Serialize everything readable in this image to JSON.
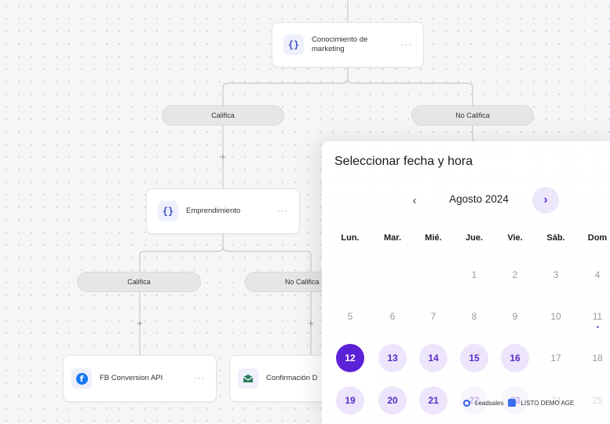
{
  "flow": {
    "nodes": {
      "root": {
        "label": "Conocimiento de marketing",
        "icon": "braces-icon",
        "more": "···"
      },
      "emprendimiento": {
        "label": "Emprendimiento",
        "icon": "braces-icon",
        "more": "···"
      },
      "fb": {
        "label": "FB Conversion API",
        "icon": "facebook-icon",
        "more": "···"
      },
      "confirmacion": {
        "label": "Confirmación D",
        "icon": "mail-icon"
      }
    },
    "branches": {
      "califica_1": "Califica",
      "no_califica_1": "No Califica",
      "califica_2": "Califica",
      "no_califica_2": "No Califica"
    },
    "plus": "+"
  },
  "calendar": {
    "title": "Seleccionar fecha y hora",
    "month": "Agosto 2024",
    "prev": "‹",
    "next": "›",
    "weekdays": [
      "Lun.",
      "Mar.",
      "Mié.",
      "Jue.",
      "Vie.",
      "Sáb.",
      "Dom"
    ],
    "weeks": [
      [
        "",
        "",
        "",
        "1",
        "2",
        "3",
        "4"
      ],
      [
        "5",
        "6",
        "7",
        "8",
        "9",
        "10",
        "11"
      ],
      [
        "12",
        "13",
        "14",
        "15",
        "16",
        "17",
        "18"
      ],
      [
        "19",
        "20",
        "21",
        "22",
        "23",
        "24",
        "25"
      ]
    ],
    "selected_day": "12",
    "available_days": [
      "13",
      "14",
      "15",
      "16",
      "19",
      "20",
      "21",
      "22",
      "23"
    ],
    "dotted_day": "11",
    "accent_color": "#5b21d6"
  },
  "watermark": {
    "brand": "Leadsales",
    "workspace": "LISTO DEMO AGE"
  }
}
